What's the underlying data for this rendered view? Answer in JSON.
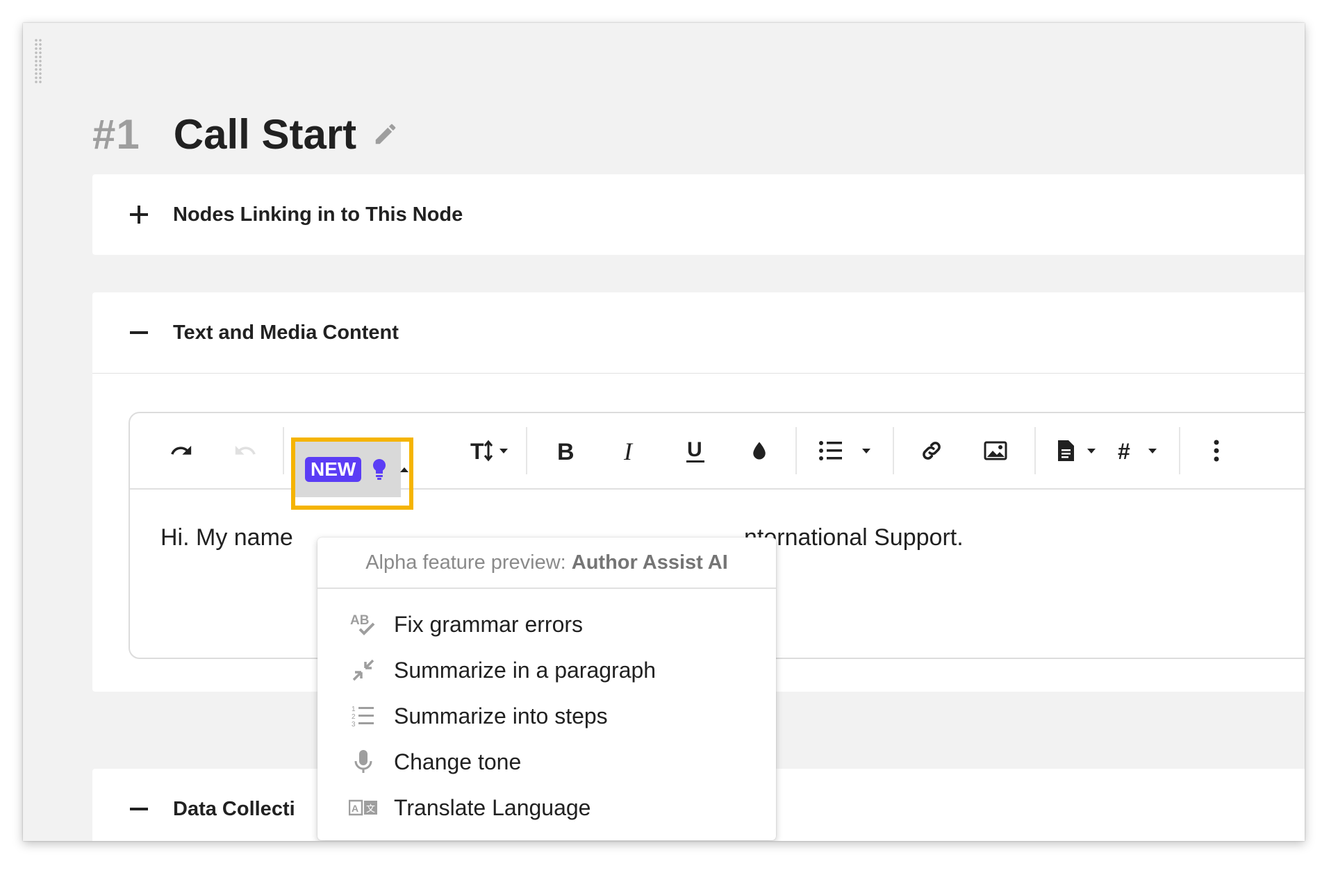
{
  "node": {
    "number": "#1",
    "title": "Call Start"
  },
  "panels": {
    "linking": {
      "title": "Nodes Linking in to This Node",
      "state": "collapsed"
    },
    "content": {
      "title": "Text and Media Content",
      "state": "expanded"
    },
    "data": {
      "title": "Data Collecti"
    }
  },
  "editor": {
    "text_left": "Hi. My name",
    "text_right": "nternational Support."
  },
  "toolbar": {
    "new_badge": "NEW",
    "icons": [
      "undo-icon",
      "redo-icon",
      "lightbulb-icon",
      "caret-up-icon",
      "text-size-icon",
      "bold-icon",
      "italic-icon",
      "underline-icon",
      "color-drop-icon",
      "bullet-list-icon",
      "link-icon",
      "image-icon",
      "document-icon",
      "hash-icon",
      "more-vertical-icon"
    ]
  },
  "ai_menu": {
    "header_prefix": "Alpha feature preview:",
    "header_name": "Author Assist AI",
    "items": [
      {
        "label": "Fix grammar errors",
        "icon": "spellcheck-icon"
      },
      {
        "label": "Summarize in a paragraph",
        "icon": "compress-arrows-icon"
      },
      {
        "label": "Summarize into steps",
        "icon": "numbered-list-icon"
      },
      {
        "label": "Change tone",
        "icon": "microphone-icon"
      },
      {
        "label": "Translate Language",
        "icon": "translate-icon"
      }
    ]
  },
  "colors": {
    "accent": "#5b3df5",
    "highlight": "#f5b400",
    "page_bg": "#f2f2f2"
  }
}
